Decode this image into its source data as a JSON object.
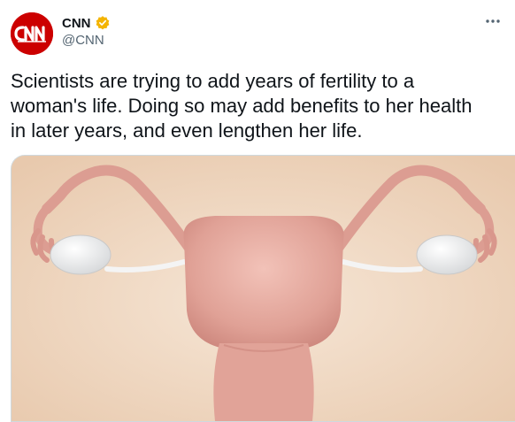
{
  "tweet": {
    "author": {
      "display_name": "CNN",
      "handle": "@CNN",
      "avatar_text": "CNN",
      "verified": true,
      "brand_color": "#cc0000",
      "verified_color": "#f4b400"
    },
    "text_lines": [
      "Scientists are trying to add years of fertility to a",
      "woman's life. Doing so may add benefits to her health",
      "in later years, and even lengthen her life."
    ],
    "more_icon": "more-horizontal-icon",
    "media": {
      "type": "illustration",
      "background_color": "#f0d9c2",
      "organ_color": "#e3a99f"
    }
  }
}
